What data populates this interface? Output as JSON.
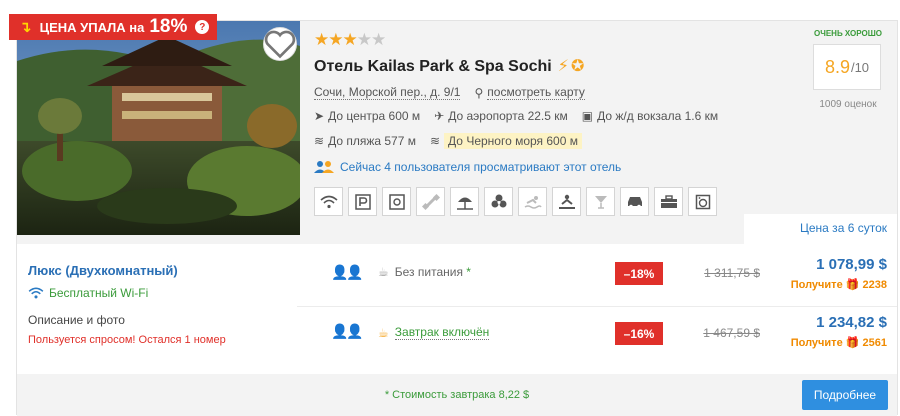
{
  "badge": {
    "prefix": "ЦЕНА УПАЛА на",
    "percent": "18%",
    "help": "?"
  },
  "hotel": {
    "stars": 3,
    "stars_max": 5,
    "name": "Отель Kailas Park & Spa Sochi",
    "address": "Сочи, Морской пер., д. 9/1",
    "map_link": "посмотреть карту",
    "distances": {
      "center": "До центра 600 м",
      "airport": "До аэропорта 22.5 км",
      "station": "До ж/д вокзала 1.6 км",
      "beach": "До пляжа 577 м",
      "sea": "До Черного моря 600 м"
    },
    "viewers": "Сейчас 4 пользователя просматривают этот отель",
    "amenities": [
      "wifi-icon",
      "parking-icon",
      "safe-icon",
      "fitness-icon",
      "beach-icon",
      "spa-icon",
      "pool-icon",
      "massage-icon",
      "bar-icon",
      "taxi-icon",
      "business-icon",
      "laundry-icon"
    ]
  },
  "rating": {
    "label": "ОЧЕНЬ ХОРОШО",
    "score": "8.9",
    "max": "/10",
    "reviews": "1009 оценок"
  },
  "price_header": "Цена за 6 суток",
  "room": {
    "name": "Люкс (Двухкомнатный)",
    "wifi": "Бесплатный Wi-Fi",
    "details_link": "Описание и фото",
    "demand": "Пользуется спросом! Остался 1 номер"
  },
  "offers": [
    {
      "meal": "Без питания",
      "meal_mark": "*",
      "discount": "–18%",
      "old_price": "1 311,75 $",
      "price": "1 078,99 $",
      "bonus_label": "Получите",
      "bonus": "2238"
    },
    {
      "meal": "Завтрак включён",
      "meal_mark": "",
      "discount": "–16%",
      "old_price": "1 467,59 $",
      "price": "1 234,82 $",
      "bonus_label": "Получите",
      "bonus": "2561"
    }
  ],
  "footer": {
    "note": "* Стоимость завтрака 8,22 $",
    "button": "Подробнее"
  },
  "colors": {
    "accent": "#2f8fe0",
    "sale": "#e0302a",
    "star": "#f5a623",
    "good": "#3a9b3a"
  }
}
